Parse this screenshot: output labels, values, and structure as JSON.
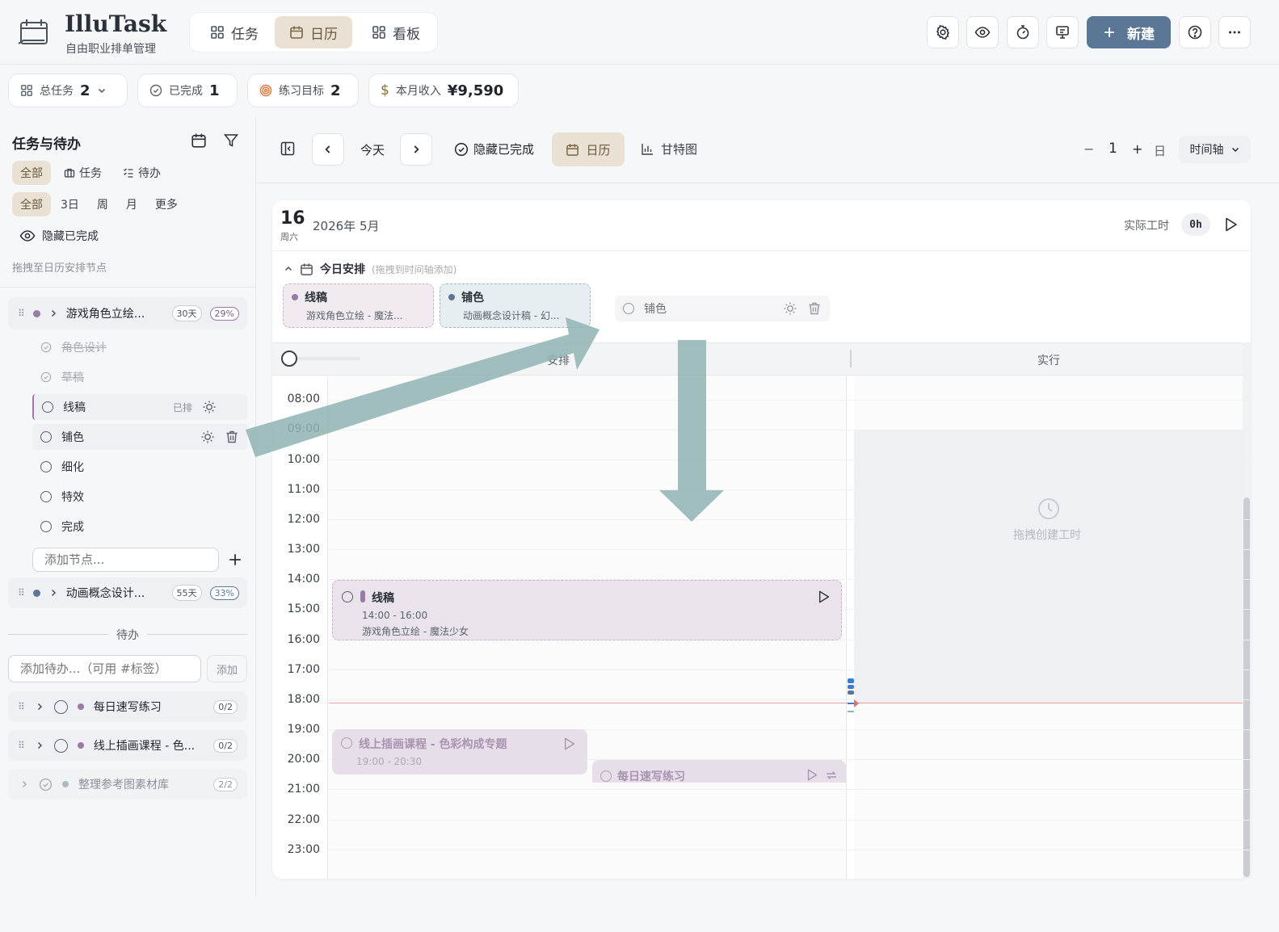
{
  "brand": {
    "name": "IlluTask",
    "subtitle": "自由职业排单管理"
  },
  "nav_tabs": [
    {
      "label": "任务",
      "active": false
    },
    {
      "label": "日历",
      "active": true
    },
    {
      "label": "看板",
      "active": false
    }
  ],
  "toolbar": {
    "new_label": "新建"
  },
  "stats": {
    "total_label": "总任务",
    "total_value": "2",
    "done_label": "已完成",
    "done_value": "1",
    "goal_label": "练习目标",
    "goal_value": "2",
    "income_label": "本月收入",
    "income_value": "¥9,590"
  },
  "sidebar": {
    "title": "任务与待办",
    "type_filters": [
      "全部",
      "任务",
      "待办"
    ],
    "range_filters": [
      "全部",
      "3日",
      "周",
      "月",
      "更多"
    ],
    "hide_done": "隐藏已完成",
    "hint": "拖拽至日历安排节点",
    "project1": {
      "name": "游戏角色立绘...",
      "days": "30天",
      "pct": "29%"
    },
    "nodes": [
      {
        "label": "角色设计",
        "done": true
      },
      {
        "label": "草稿",
        "done": true
      },
      {
        "label": "线稿",
        "done": false,
        "tag": "已排"
      },
      {
        "label": "铺色",
        "done": false
      },
      {
        "label": "细化",
        "done": false
      },
      {
        "label": "特效",
        "done": false
      },
      {
        "label": "完成",
        "done": false
      }
    ],
    "add_node_placeholder": "添加节点...",
    "project2": {
      "name": "动画概念设计...",
      "days": "55天",
      "pct": "33%"
    },
    "todo_divider": "待办",
    "todo_placeholder": "添加待办...（可用 #标签）",
    "todo_add": "添加",
    "todos": [
      {
        "label": "每日速写练习",
        "count": "0/2"
      },
      {
        "label": "线上插画课程 - 色...",
        "count": "0/2"
      },
      {
        "label": "整理参考图素材库",
        "count": "2/2"
      }
    ]
  },
  "cal_toolbar": {
    "today": "今天",
    "hide_done": "隐藏已完成",
    "calendar": "日历",
    "gantt": "甘特图",
    "minus": "−",
    "count": "1",
    "plus": "+",
    "unit": "日",
    "view": "时间轴"
  },
  "day": {
    "date": "16",
    "weekday": "周六",
    "month": "2026年 5月",
    "actual_label": "实际工时",
    "actual_value": "0h"
  },
  "today_plan": {
    "title": "今日安排",
    "hint": "(拖拽到时间轴添加)",
    "cards": [
      {
        "title": "线稿",
        "sub": "游戏角色立绘 - 魔法..."
      },
      {
        "title": "铺色",
        "sub": "动画概念设计稿 - 幻..."
      }
    ],
    "drag_item": "铺色"
  },
  "columns": {
    "plan": "安排",
    "actual": "实行"
  },
  "hours": [
    "08:00",
    "09:00",
    "10:00",
    "11:00",
    "12:00",
    "13:00",
    "14:00",
    "15:00",
    "16:00",
    "17:00",
    "18:00",
    "19:00",
    "20:00",
    "21:00",
    "22:00",
    "23:00"
  ],
  "events": {
    "e1": {
      "title": "线稿",
      "time": "14:00 - 16:00",
      "project": "游戏角色立绘 - 魔法少女"
    },
    "e2": {
      "title": "线上插画课程 - 色彩构成专题",
      "time": "19:00 - 20:30"
    },
    "e3": {
      "title": "每日速写练习"
    }
  },
  "actual_empty": "拖拽创建工时",
  "colors": {
    "accent": "#5a7896",
    "arrow": "#8fb3b3",
    "now_line": "#e9a0a0"
  }
}
